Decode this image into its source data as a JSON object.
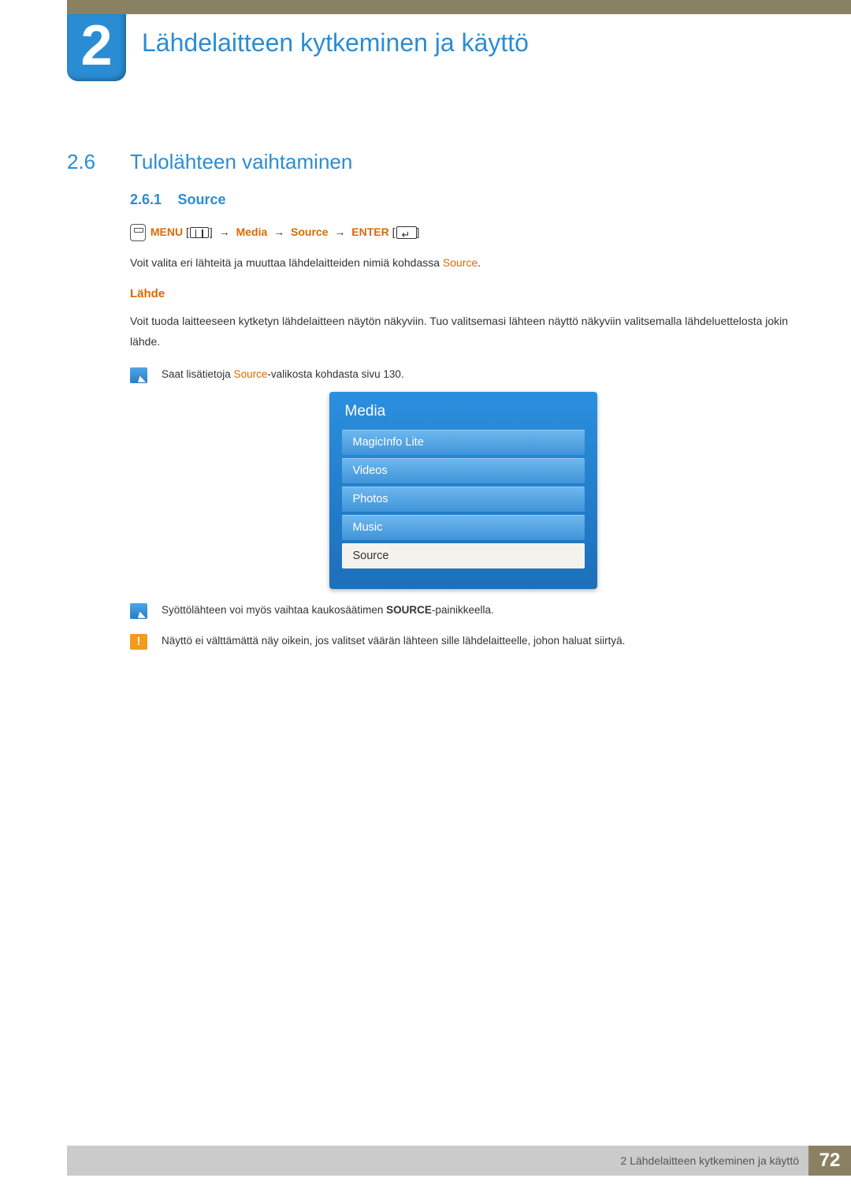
{
  "chapter": {
    "number": "2",
    "title": "Lähdelaitteen kytkeminen ja käyttö"
  },
  "section": {
    "number": "2.6",
    "title": "Tulolähteen vaihtaminen"
  },
  "subsection": {
    "number": "2.6.1",
    "title": "Source"
  },
  "nav": {
    "menu": "MENU",
    "media": "Media",
    "source": "Source",
    "enter": "ENTER"
  },
  "para1_a": "Voit valita eri lähteitä ja muuttaa lähdelaitteiden nimiä kohdassa ",
  "para1_source": "Source",
  "para1_b": ".",
  "lahde_heading": "Lähde",
  "para2": "Voit tuoda laitteeseen kytketyn lähdelaitteen näytön näkyviin. Tuo valitsemasi lähteen näyttö näkyviin valitsemalla lähdeluettelosta jokin lähde.",
  "note1_a": "Saat lisätietoja ",
  "note1_src": "Source",
  "note1_b": "-valikosta kohdasta sivu 130.",
  "media_panel": {
    "title": "Media",
    "items": [
      "MagicInfo Lite",
      "Videos",
      "Photos",
      "Music",
      "Source"
    ],
    "selected_index": 4
  },
  "note2_a": "Syöttölähteen voi myös vaihtaa kaukosäätimen ",
  "note2_bold": "SOURCE",
  "note2_b": "-painikkeella.",
  "warn": "Näyttö ei välttämättä näy oikein, jos valitset väärän lähteen sille lähdelaitteelle, johon haluat siirtyä.",
  "footer": {
    "text": "2 Lähdelaitteen kytkeminen ja käyttö",
    "page": "72"
  }
}
